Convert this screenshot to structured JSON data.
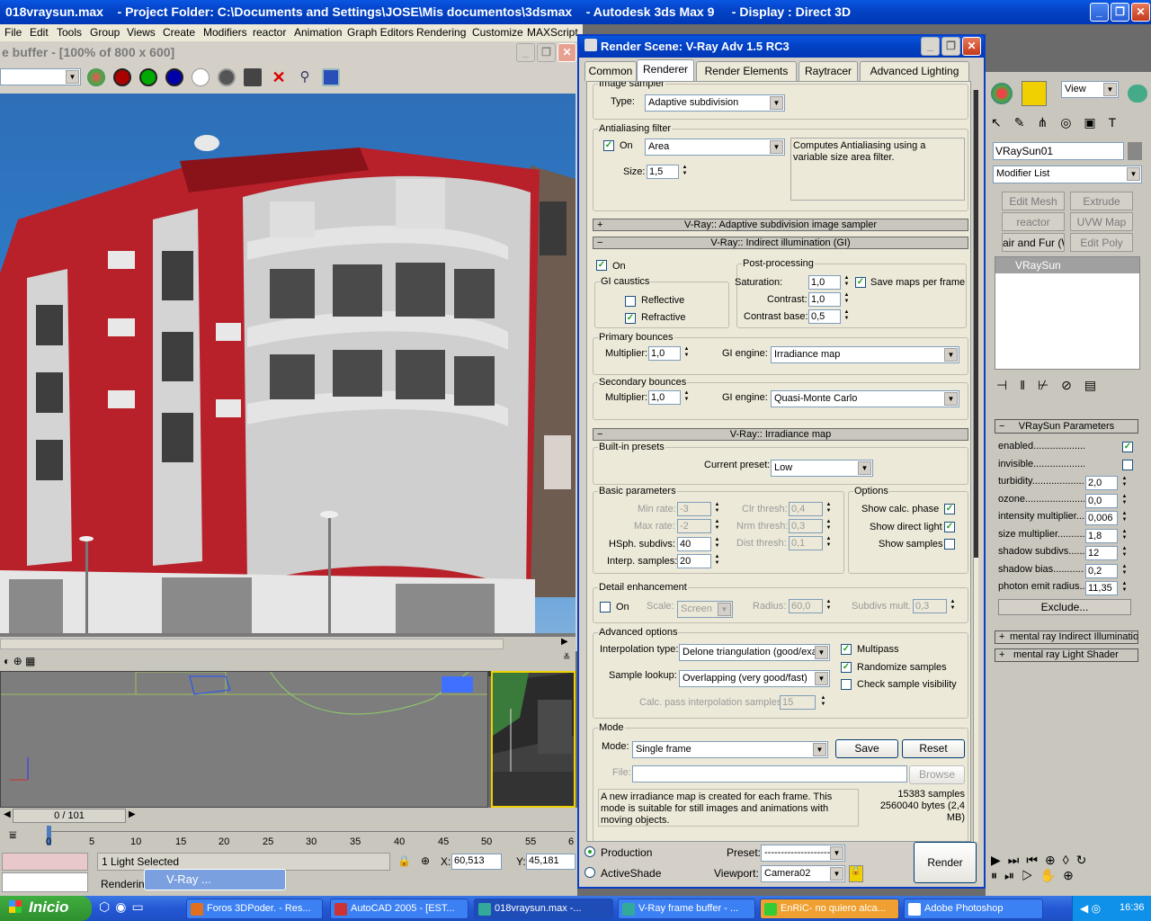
{
  "window": {
    "title": "018vraysun.max    - Project Folder: C:\\Documents and Settings\\JOSE\\Mis documentos\\3dsmax    - Autodesk 3ds Max 9     - Display : Direct 3D"
  },
  "menu": [
    "File",
    "Edit",
    "Tools",
    "Group",
    "Views",
    "Create",
    "Modifiers",
    "reactor",
    "Animation",
    "Graph Editors",
    "Rendering",
    "Customize",
    "MAXScript"
  ],
  "framebuffer": {
    "title": "e buffer - [100% of 800 x 600]"
  },
  "dialog": {
    "title": "Render Scene: V-Ray Adv 1.5 RC3",
    "tabs": [
      "Common",
      "Renderer",
      "Render Elements",
      "Raytracer",
      "Advanced Lighting"
    ],
    "image_sampler": {
      "group": "Image sampler",
      "type_label": "Type:",
      "type_value": "Adaptive subdivision"
    },
    "aa": {
      "group": "Antialiasing filter",
      "on_label": "On",
      "filter": "Area",
      "desc": "Computes Antialiasing using a variable size area filter.",
      "size_label": "Size:",
      "size": "1,5"
    },
    "rollouts": {
      "adaptive": "V-Ray:: Adaptive subdivision image sampler",
      "gi": "V-Ray:: Indirect illumination (GI)",
      "irr": "V-Ray:: Irradiance map"
    },
    "gi": {
      "on_label": "On",
      "caustics": {
        "group": "GI caustics",
        "reflective": "Reflective",
        "refractive": "Refractive"
      },
      "post": {
        "group": "Post-processing",
        "saturation_label": "Saturation:",
        "saturation": "1,0",
        "contrast_label": "Contrast:",
        "contrast": "1,0",
        "contrast_base_label": "Contrast base:",
        "contrast_base": "0,5",
        "save_maps": "Save maps per frame"
      },
      "primary": {
        "group": "Primary bounces",
        "mult_label": "Multiplier:",
        "mult": "1,0",
        "engine_label": "GI engine:",
        "engine": "Irradiance map"
      },
      "secondary": {
        "group": "Secondary bounces",
        "mult_label": "Multiplier:",
        "mult": "1,0",
        "engine_label": "GI engine:",
        "engine": "Quasi-Monte Carlo"
      }
    },
    "irr": {
      "presets": {
        "group": "Built-in presets",
        "current_label": "Current preset:",
        "current": "Low"
      },
      "basic": {
        "group": "Basic parameters",
        "min_rate_label": "Min rate:",
        "min_rate": "-3",
        "max_rate_label": "Max rate:",
        "max_rate": "-2",
        "hsph_label": "HSph. subdivs:",
        "hsph": "40",
        "interp_label": "Interp. samples:",
        "interp": "20",
        "clr_label": "Clr thresh:",
        "clr": "0,4",
        "nrm_label": "Nrm thresh:",
        "nrm": "0,3",
        "dist_label": "Dist thresh:",
        "dist": "0,1"
      },
      "options": {
        "group": "Options",
        "calc_phase": "Show calc. phase",
        "direct_light": "Show direct light",
        "samples": "Show samples"
      },
      "detail": {
        "group": "Detail enhancement",
        "on_label": "On",
        "scale_label": "Scale:",
        "scale": "Screen",
        "radius_label": "Radius:",
        "radius": "60,0",
        "subdivs_label": "Subdivs mult.",
        "subdivs": "0,3"
      },
      "advanced": {
        "group": "Advanced options",
        "interp_type_label": "Interpolation type:",
        "interp_type": "Delone triangulation (good/exa",
        "lookup_label": "Sample lookup:",
        "lookup": "Overlapping (very good/fast)",
        "multipass": "Multipass",
        "randomize": "Randomize samples",
        "check_vis": "Check sample visibility",
        "calc_pass_label": "Calc. pass interpolation samples:",
        "calc_pass": "15"
      },
      "mode": {
        "group": "Mode",
        "mode_label": "Mode:",
        "mode": "Single frame",
        "save": "Save",
        "reset": "Reset",
        "file_label": "File:",
        "browse": "Browse",
        "desc": "A new irradiance map is created for each frame. This mode is suitable for still images and animations with moving objects.",
        "stats": "15383 samples 2560040 bytes (2,4 MB)"
      }
    },
    "bottom": {
      "production": "Production",
      "activeshade": "ActiveShade",
      "preset_label": "Preset:",
      "preset": "----------------------",
      "viewport_label": "Viewport:",
      "viewport": "Camera02",
      "render": "Render"
    }
  },
  "cmdpanel": {
    "view": "View",
    "object_name": "VRaySun01",
    "modifier_list": "Modifier List",
    "buttons": [
      "Edit Mesh",
      "Extrude",
      "reactor Cloth",
      "UVW Map",
      "air and Fur (WS",
      "Edit Poly"
    ],
    "stack_item": "VRaySun",
    "rollout": "VRaySun Parameters",
    "params": [
      {
        "label": "enabled.........................",
        "value": "",
        "check": true
      },
      {
        "label": "invisible.........................",
        "value": "",
        "check": false
      },
      {
        "label": "turbidity...................",
        "value": "2,0"
      },
      {
        "label": "ozone.......................",
        "value": "0,0"
      },
      {
        "label": "intensity multiplier....",
        "value": "0,006"
      },
      {
        "label": "size multiplier..........",
        "value": "1,8"
      },
      {
        "label": "shadow subdivs........",
        "value": "12"
      },
      {
        "label": "shadow bias.............",
        "value": "0,2"
      },
      {
        "label": "photon emit radius..",
        "value": "11,35"
      }
    ],
    "exclude": "Exclude...",
    "mr_gi": "mental ray Indirect Illumination",
    "mr_ls": "mental ray Light Shader"
  },
  "timeline": {
    "frame": "0 / 101",
    "ticks": [
      "0",
      "5",
      "10",
      "15",
      "20",
      "25",
      "30",
      "35",
      "40",
      "45",
      "50",
      "55",
      "6"
    ]
  },
  "status": {
    "selected": "1 Light Selected",
    "x_label": "X:",
    "x": "60,513",
    "y_label": "Y:",
    "y": "45,181",
    "rendering": "Rendering",
    "min_task": "V-Ray ..."
  },
  "taskbar": {
    "start": "Inicio",
    "tasks": [
      "Foros 3DPoder. - Res...",
      "AutoCAD 2005 - [EST...",
      "018vraysun.max   -...",
      "V-Ray frame buffer - ...",
      "EnRiC- no quiero alca...",
      "Adobe Photoshop"
    ],
    "clock": "16:36"
  },
  "colors": {
    "xp_blue": "#0342c4",
    "building_red": "#b8202a",
    "panel": "#ece9d8"
  }
}
